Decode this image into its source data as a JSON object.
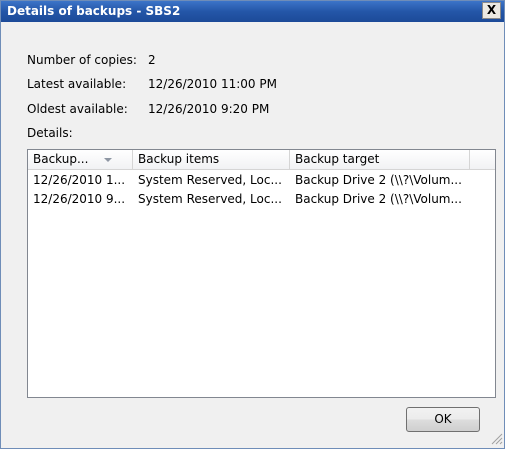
{
  "window": {
    "title": "Details of backups - SBS2",
    "close_label": "X"
  },
  "info": {
    "copies_label": "Number of copies:",
    "copies_value": "2",
    "latest_label": "Latest available:",
    "latest_value": "12/26/2010 11:00 PM",
    "oldest_label": "Oldest available:",
    "oldest_value": "12/26/2010 9:20 PM",
    "details_label": "Details:"
  },
  "table": {
    "columns": [
      "Backup...",
      "Backup items",
      "Backup target"
    ],
    "sort_icon": "sort-descending-icon",
    "rows": [
      [
        "12/26/2010 1...",
        "System Reserved, Loc...",
        "Backup Drive 2 (\\\\?\\Volum..."
      ],
      [
        "12/26/2010 9...",
        "System Reserved, Loc...",
        "Backup Drive 2 (\\\\?\\Volum..."
      ]
    ]
  },
  "buttons": {
    "ok_label": "OK"
  },
  "colors": {
    "titlebar": "#2456a8",
    "dialog_bg": "#f0f0f0"
  }
}
